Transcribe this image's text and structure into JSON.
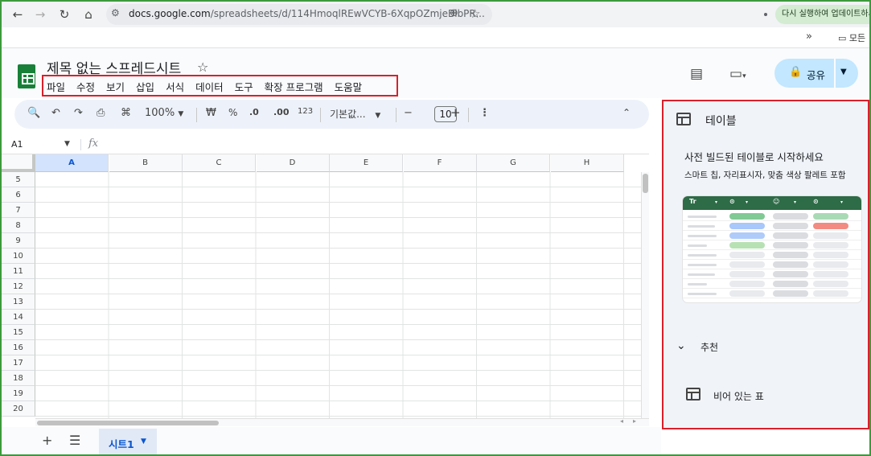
{
  "browser": {
    "url_host": "docs.google.com",
    "url_path": "/spreadsheets/d/114HmoqlREwVCYB-6XqpOZmjeBlbPR...",
    "update_label": "다시 실행하여 업데이트하세요",
    "bookmark_chevron": "»",
    "bookmark_folder": "모든"
  },
  "doc": {
    "title": "제목 없는 스프레드시트",
    "menu": [
      "파일",
      "수정",
      "보기",
      "삽입",
      "서식",
      "데이터",
      "도구",
      "확장 프로그램",
      "도움말"
    ],
    "share_label": "공유"
  },
  "toolbar": {
    "zoom": "100%",
    "currency": "₩",
    "percent": "%",
    "decrease_decimal": ".0",
    "increase_decimal": ".00",
    "number_format": "123",
    "font": "기본값...",
    "font_size": "10",
    "minus": "−",
    "plus": "+"
  },
  "formula_bar": {
    "cell_ref": "A1",
    "fx": "fx"
  },
  "grid": {
    "columns": [
      "A",
      "B",
      "C",
      "D",
      "E",
      "F",
      "G",
      "H"
    ],
    "rows": [
      "5",
      "6",
      "7",
      "8",
      "9",
      "10",
      "11",
      "12",
      "13",
      "14",
      "15",
      "16",
      "17",
      "18",
      "19",
      "20"
    ],
    "selected_column": "A"
  },
  "sheet_tabs": [
    {
      "label": "시트1"
    }
  ],
  "side_panel": {
    "title": "테이블",
    "heading": "사전 빌드된 테이블로 시작하세요",
    "subtext": "스마트 칩, 자리표시자, 맞춤 색상 팔레트 포함",
    "preview_header_label": "Tr",
    "recommended_label": "추천",
    "empty_table_label": "비어 있는 표"
  },
  "colors": {
    "accent": "#0b57d0",
    "share_bg": "#c2e7ff",
    "highlight_border": "#d9202b",
    "sheets_green": "#188038",
    "preview_header": "#2e6b47"
  }
}
